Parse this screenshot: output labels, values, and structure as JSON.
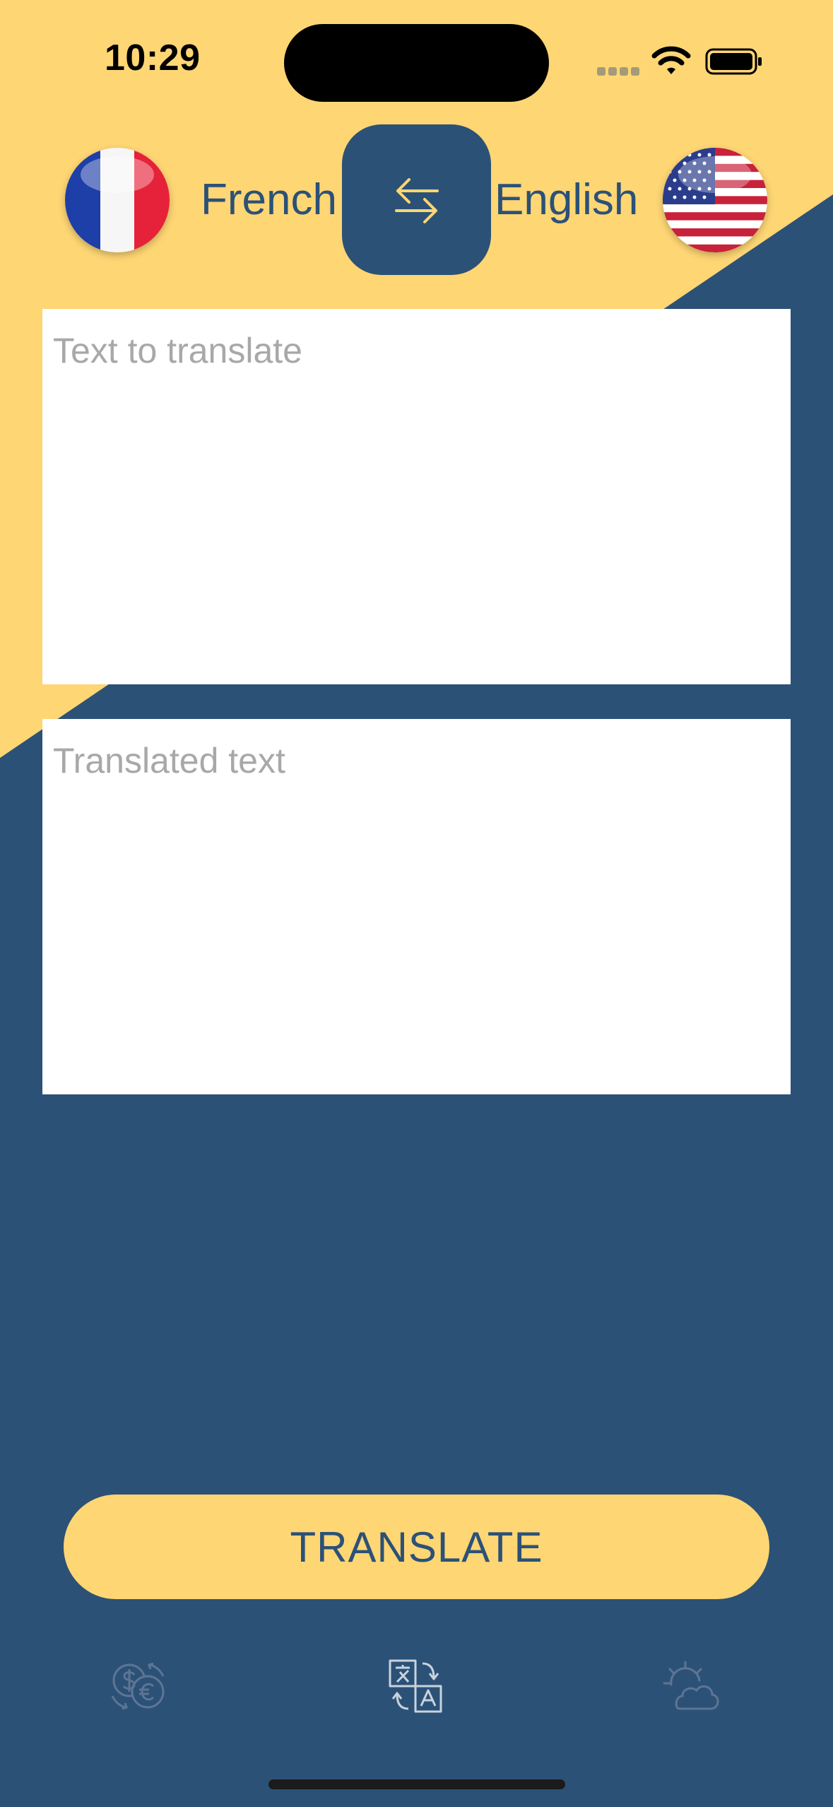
{
  "status_bar": {
    "time": "10:29"
  },
  "language_bar": {
    "source_language": "French",
    "target_language": "English",
    "source_flag_icon": "france-flag-icon",
    "target_flag_icon": "usa-flag-icon",
    "swap_icon": "swap-arrows-icon"
  },
  "source_text": {
    "value": "",
    "placeholder": "Text to translate"
  },
  "translated_text": {
    "value": "",
    "placeholder": "Translated text"
  },
  "translate_button": {
    "label": "TRANSLATE"
  },
  "tab_bar": {
    "tabs": [
      {
        "icon": "currency-exchange-icon",
        "selected": false
      },
      {
        "icon": "translate-icon",
        "selected": true
      },
      {
        "icon": "weather-icon",
        "selected": false
      }
    ]
  },
  "colors": {
    "primary_navy": "#2c5177",
    "accent_yellow": "#fed674",
    "placeholder_gray": "#a8a8a8",
    "tab_inactive": "#5d7594"
  }
}
